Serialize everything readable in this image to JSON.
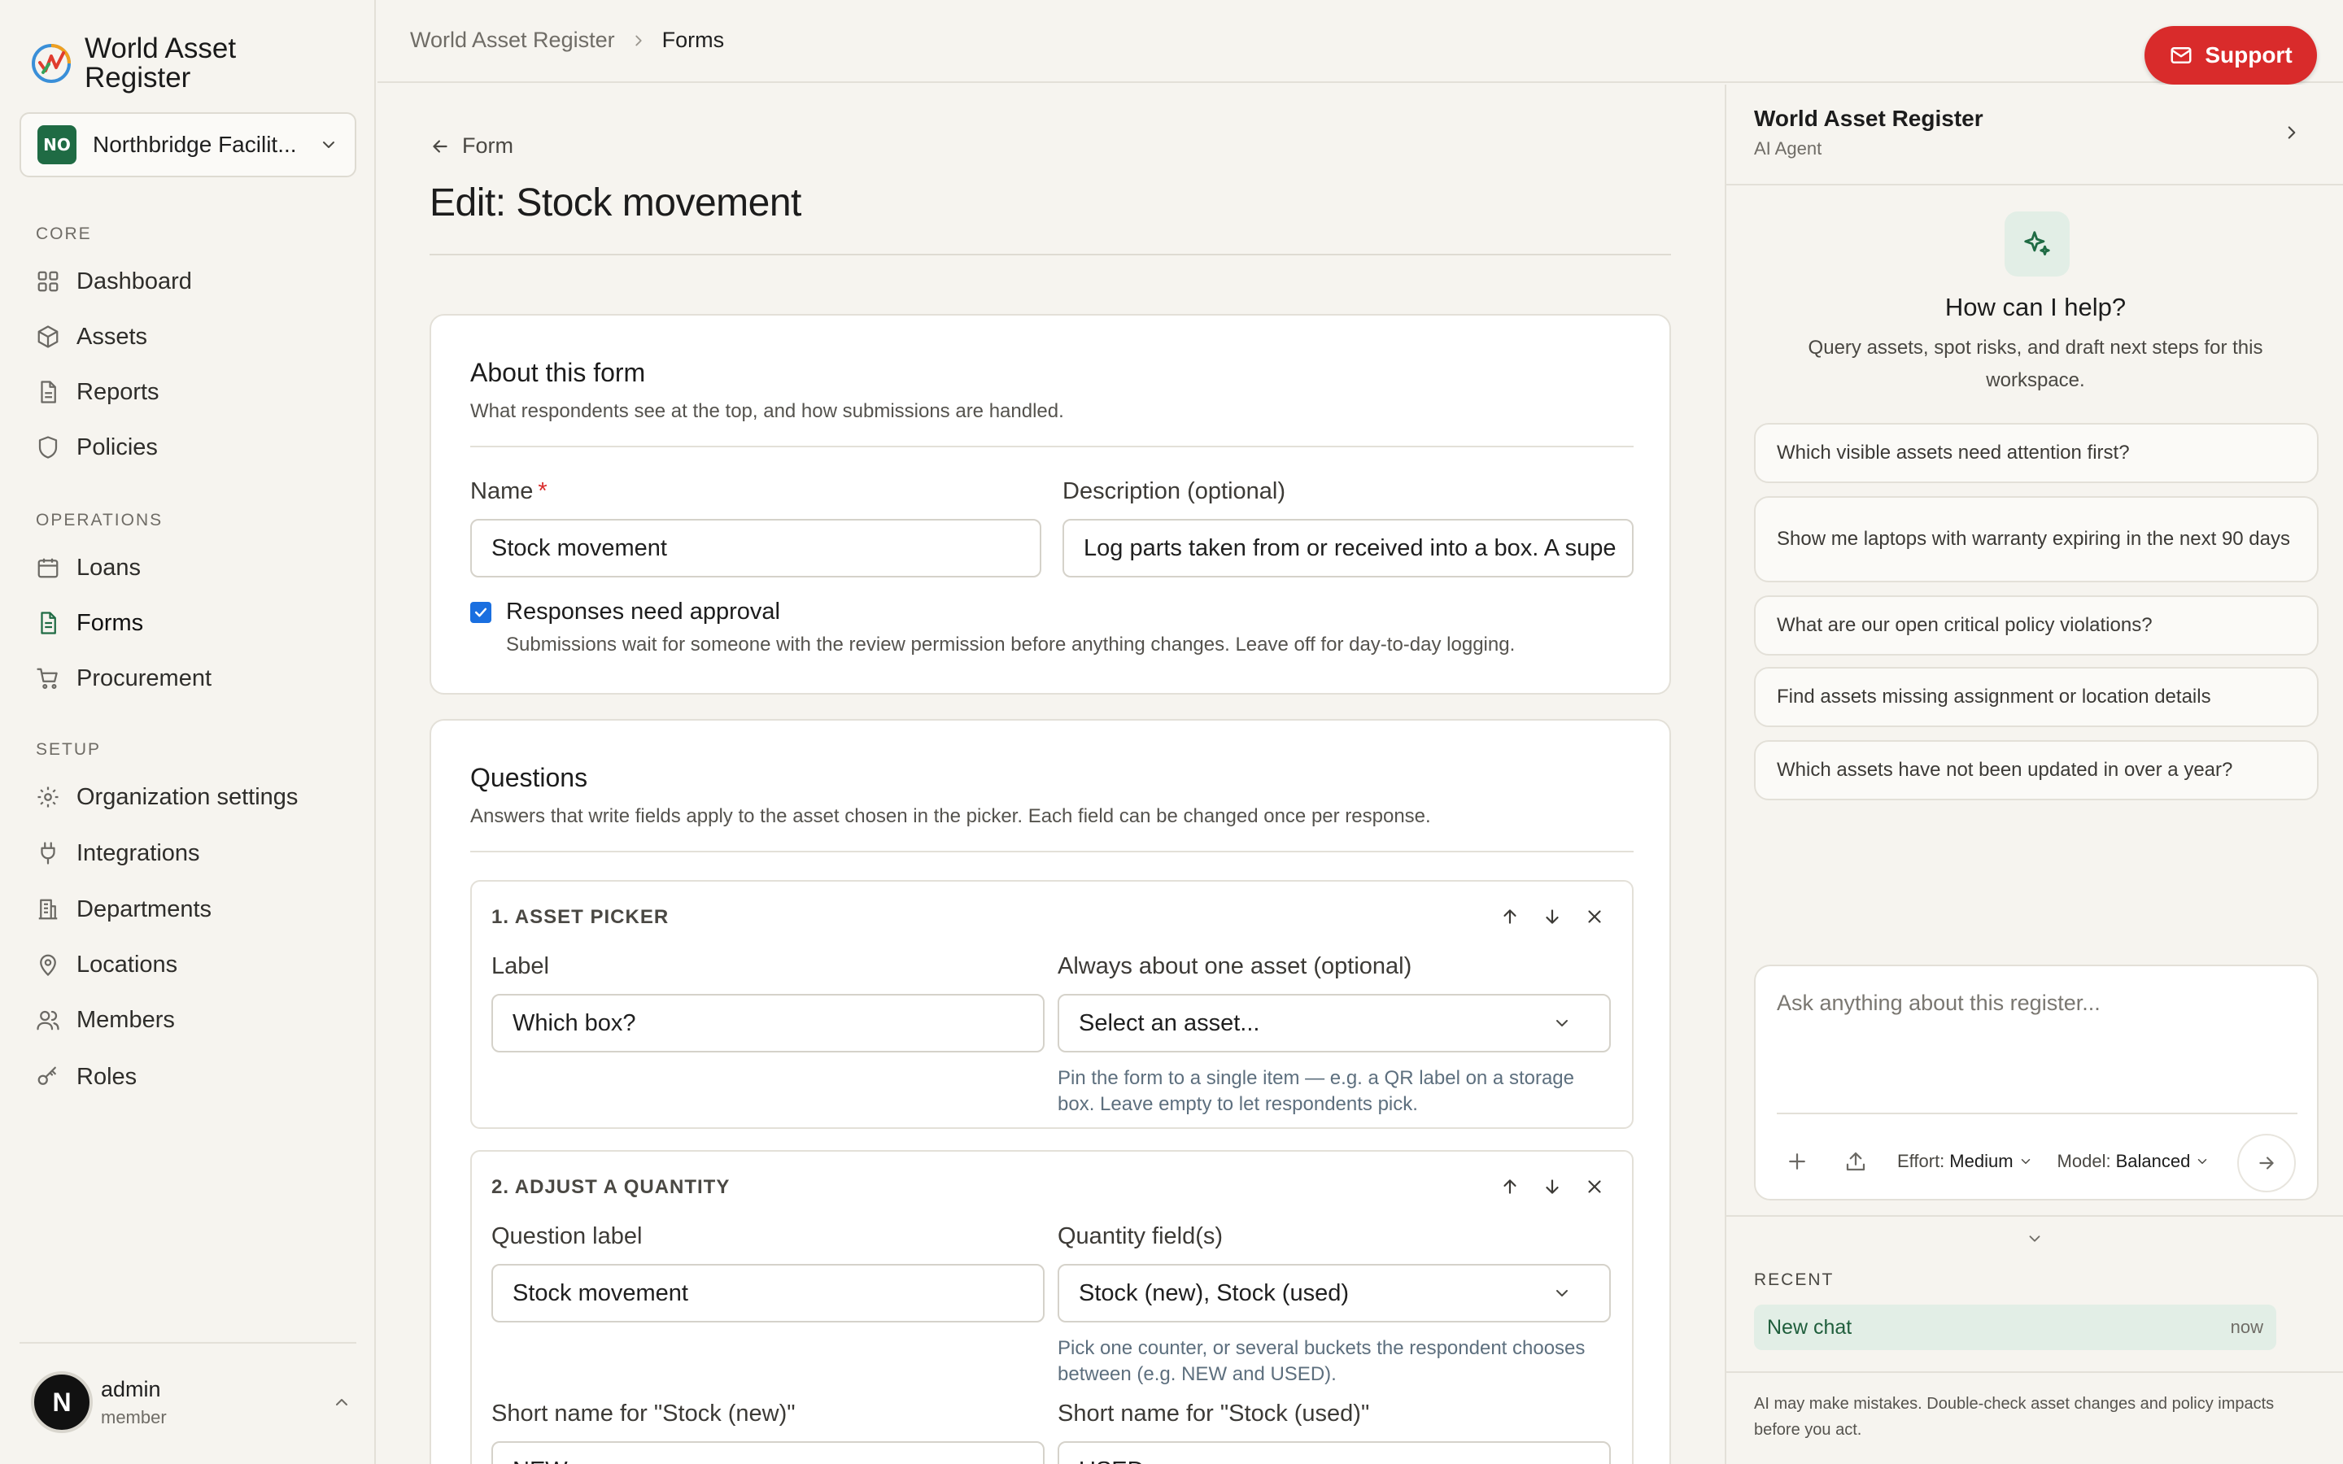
{
  "app": {
    "name": "World Asset Register",
    "accent": "#1f6b44",
    "danger": "#d92b2b"
  },
  "org": {
    "initials": "NO",
    "name": "Northbridge Facilit..."
  },
  "nav": {
    "core_label": "CORE",
    "core": [
      {
        "label": "Dashboard",
        "icon": "grid-icon"
      },
      {
        "label": "Assets",
        "icon": "cube-icon"
      },
      {
        "label": "Reports",
        "icon": "document-icon"
      },
      {
        "label": "Policies",
        "icon": "shield-icon"
      }
    ],
    "operations_label": "OPERATIONS",
    "operations": [
      {
        "label": "Loans",
        "icon": "calendar-icon"
      },
      {
        "label": "Forms",
        "icon": "form-icon",
        "active": true
      },
      {
        "label": "Procurement",
        "icon": "cart-icon"
      }
    ],
    "setup_label": "SETUP",
    "setup": [
      {
        "label": "Organization settings",
        "icon": "gear-icon"
      },
      {
        "label": "Integrations",
        "icon": "plug-icon"
      },
      {
        "label": "Departments",
        "icon": "building-icon"
      },
      {
        "label": "Locations",
        "icon": "pin-icon"
      },
      {
        "label": "Members",
        "icon": "users-icon"
      },
      {
        "label": "Roles",
        "icon": "key-icon"
      }
    ]
  },
  "user": {
    "initial": "N",
    "name": "admin",
    "role": "member"
  },
  "header": {
    "breadcrumb": [
      "World Asset Register",
      "Forms"
    ],
    "support_label": "Support"
  },
  "page": {
    "back_label": "Form",
    "title": "Edit: Stock movement"
  },
  "about": {
    "title": "About this form",
    "subtitle": "What respondents see at the top, and how submissions are handled.",
    "name_label": "Name",
    "required_mark": "*",
    "name_value": "Stock movement",
    "description_label": "Description (optional)",
    "description_value": "Log parts taken from or received into a box. A supe",
    "approval_checked": true,
    "approval_label": "Responses need approval",
    "approval_help": "Submissions wait for someone with the review permission before anything changes. Leave off for day-to-day logging."
  },
  "questions": {
    "title": "Questions",
    "subtitle": "Answers that write fields apply to the asset chosen in the picker. Each field can be changed once per response.",
    "q1": {
      "heading": "1. ASSET PICKER",
      "label_label": "Label",
      "label_value": "Which box?",
      "asset_label": "Always about one asset (optional)",
      "asset_value": "Select an asset...",
      "asset_help": "Pin the form to a single item — e.g. a QR label on a storage box. Leave empty to let respondents pick."
    },
    "q2": {
      "heading": "2. ADJUST A QUANTITY",
      "question_label": "Question label",
      "question_value": "Stock movement",
      "fields_label": "Quantity field(s)",
      "fields_value": "Stock (new), Stock (used)",
      "fields_help": "Pick one counter, or several buckets the respondent chooses between (e.g. NEW and USED).",
      "short_new_label": "Short name for \"Stock (new)\"",
      "short_new_value": "NEW",
      "short_used_label": "Short name for \"Stock (used)\"",
      "short_used_value": "USED"
    }
  },
  "ai": {
    "title": "World Asset Register",
    "subtitle": "AI Agent",
    "help_title": "How can I help?",
    "help_sub": "Query assets, spot risks, and draft next steps for this workspace.",
    "suggestions": [
      "Which visible assets need attention first?",
      "Show me laptops with warranty expiring in the next 90 days",
      "What are our open critical policy violations?",
      "Find assets missing assignment or location details",
      "Which assets have not been updated in over a year?"
    ],
    "composer_placeholder": "Ask anything about this register...",
    "effort_label": "Effort:",
    "effort_value": "Medium",
    "model_label": "Model:",
    "model_value": "Balanced",
    "recent_label": "RECENT",
    "recent": [
      {
        "name": "New chat",
        "time": "now"
      }
    ],
    "disclaimer": "AI may make mistakes. Double-check asset changes and policy impacts before you act."
  }
}
